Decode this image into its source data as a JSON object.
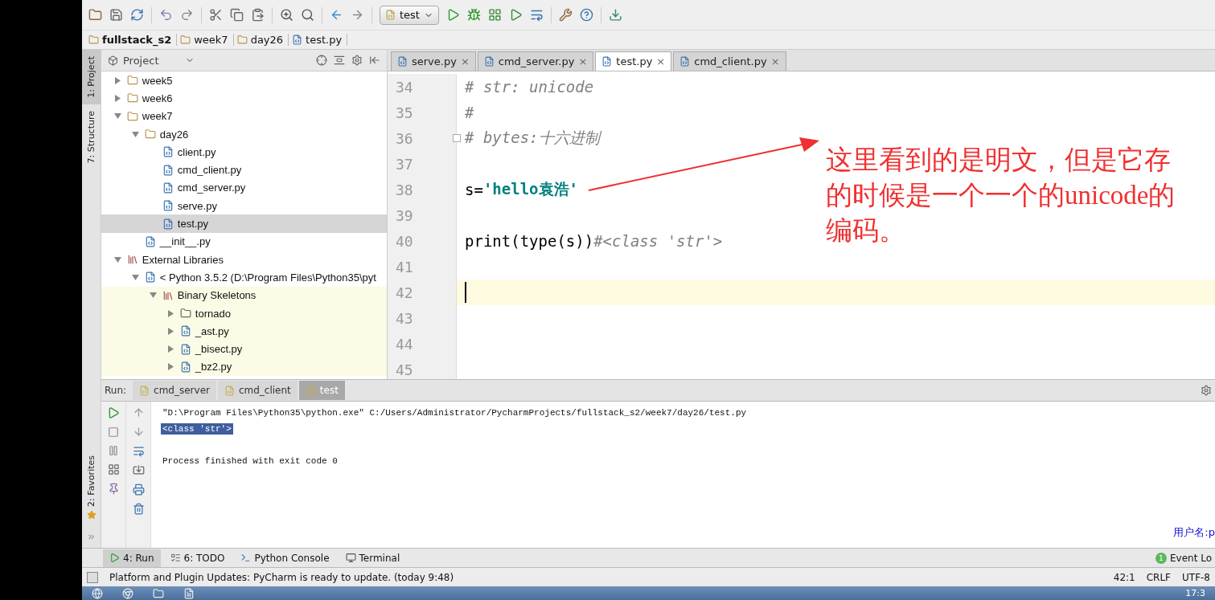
{
  "run_config": "test",
  "breadcrumbs": [
    {
      "label": "fullstack_s2",
      "bold": true
    },
    {
      "label": "week7",
      "bold": false
    },
    {
      "label": "day26",
      "bold": false
    },
    {
      "label": "test.py",
      "bold": false
    }
  ],
  "side_tools_top": [
    {
      "label": "1: Project",
      "selected": true
    },
    {
      "label": "7: Structure",
      "selected": false
    }
  ],
  "side_tools_bottom": [
    {
      "label": "2: Favorites",
      "selected": false
    }
  ],
  "project_panel": {
    "title": "Project",
    "tree": [
      {
        "label": "week5",
        "kind": "folder",
        "expanded": false,
        "selected": false,
        "library": false
      },
      {
        "label": "week6",
        "kind": "folder",
        "expanded": false,
        "selected": false,
        "library": false
      },
      {
        "label": "week7",
        "kind": "folder",
        "expanded": true,
        "selected": false,
        "library": false,
        "children": [
          {
            "label": "day26",
            "kind": "folder",
            "expanded": true,
            "selected": false,
            "library": false,
            "children": [
              {
                "label": "client.py",
                "kind": "file",
                "selected": false,
                "library": false
              },
              {
                "label": "cmd_client.py",
                "kind": "file",
                "selected": false,
                "library": false
              },
              {
                "label": "cmd_server.py",
                "kind": "file",
                "selected": false,
                "library": false
              },
              {
                "label": "serve.py",
                "kind": "file",
                "selected": false,
                "library": false
              },
              {
                "label": "test.py",
                "kind": "file",
                "selected": true,
                "library": false
              }
            ]
          },
          {
            "label": "__init__.py",
            "kind": "file",
            "selected": false,
            "library": false
          }
        ]
      },
      {
        "label": "External Libraries",
        "kind": "library",
        "expanded": true,
        "selected": false,
        "library": false,
        "children": [
          {
            "label": "< Python 3.5.2 (D:\\Program Files\\Python35\\pyt",
            "kind": "python",
            "expanded": true,
            "selected": false,
            "library": false,
            "children": [
              {
                "label": "Binary Skeletons",
                "kind": "library",
                "expanded": true,
                "selected": false,
                "library": true,
                "children": [
                  {
                    "label": "tornado",
                    "kind": "plainfolder",
                    "expanded": false,
                    "selected": false,
                    "library": true
                  },
                  {
                    "label": "_ast.py",
                    "kind": "file",
                    "expanded": false,
                    "selected": false,
                    "library": true
                  },
                  {
                    "label": "_bisect.py",
                    "kind": "file",
                    "expanded": false,
                    "selected": false,
                    "library": true
                  },
                  {
                    "label": "_bz2.py",
                    "kind": "file",
                    "expanded": false,
                    "selected": false,
                    "library": true
                  }
                ]
              }
            ]
          }
        ]
      }
    ]
  },
  "editor_tabs": [
    {
      "label": "serve.py",
      "selected": false,
      "close": "×"
    },
    {
      "label": "cmd_server.py",
      "selected": false,
      "close": "×"
    },
    {
      "label": "test.py",
      "selected": true,
      "close": "×"
    },
    {
      "label": "cmd_client.py",
      "selected": false,
      "close": "×"
    }
  ],
  "code_lines": [
    {
      "number": "34",
      "current": false,
      "fold": false,
      "segments": [
        {
          "kind": "comment",
          "text": "# str: unicode"
        }
      ]
    },
    {
      "number": "35",
      "current": false,
      "fold": false,
      "segments": [
        {
          "kind": "comment",
          "text": "#"
        }
      ]
    },
    {
      "number": "36",
      "current": false,
      "fold": true,
      "segments": [
        {
          "kind": "comment",
          "text": "# bytes:十六进制"
        }
      ]
    },
    {
      "number": "37",
      "current": false,
      "fold": false
    },
    {
      "number": "38",
      "current": false,
      "fold": false,
      "segments": [
        {
          "kind": "plain",
          "text": "s="
        },
        {
          "kind": "string",
          "text": "'hello袁浩'"
        }
      ]
    },
    {
      "number": "39",
      "current": false,
      "fold": false
    },
    {
      "number": "40",
      "current": false,
      "fold": false,
      "segments": [
        {
          "kind": "plain",
          "text": "print(type(s))"
        },
        {
          "kind": "comment",
          "text": "#<class 'str'>"
        }
      ]
    },
    {
      "number": "41",
      "current": false,
      "fold": false
    },
    {
      "number": "42",
      "current": true,
      "fold": false
    },
    {
      "number": "43",
      "current": false,
      "fold": false
    },
    {
      "number": "44",
      "current": false,
      "fold": false
    },
    {
      "number": "45",
      "current": false,
      "fold": false
    }
  ],
  "annotation": "这里看到的是明文，但是它存的时候是一个一个的unicode的编码。",
  "run_panel": {
    "label": "Run:",
    "tabs": [
      {
        "label": "cmd_server",
        "selected": false
      },
      {
        "label": "cmd_client",
        "selected": false
      },
      {
        "label": "test",
        "selected": true
      }
    ],
    "output": [
      {
        "text": "\"D:\\Program Files\\Python35\\python.exe\" C:/Users/Administrator/PycharmProjects/fullstack_s2/week7/day26/test.py",
        "selected": false
      },
      {
        "text": "<class 'str'>",
        "selected": true
      },
      {
        "text": "Process finished with exit code 0",
        "selected": false
      }
    ],
    "overlay_text": "用户名:p"
  },
  "tool_tabs": [
    {
      "label": "4: Run",
      "selected": true,
      "kind": "run"
    },
    {
      "label": "6: TODO",
      "selected": false,
      "kind": "todo"
    },
    {
      "label": "Python Console",
      "selected": false,
      "kind": "console"
    },
    {
      "label": "Terminal",
      "selected": false,
      "kind": "terminal"
    }
  ],
  "event_log": {
    "label": "Event Lo",
    "count": "1"
  },
  "status_bar": {
    "message": "Platform and Plugin Updates: PyCharm is ready to update. (today 9:48)",
    "position": "42:1",
    "line_sep": "CRLF",
    "encoding": "UTF-8"
  },
  "taskbar": {
    "clock": "17:3"
  }
}
